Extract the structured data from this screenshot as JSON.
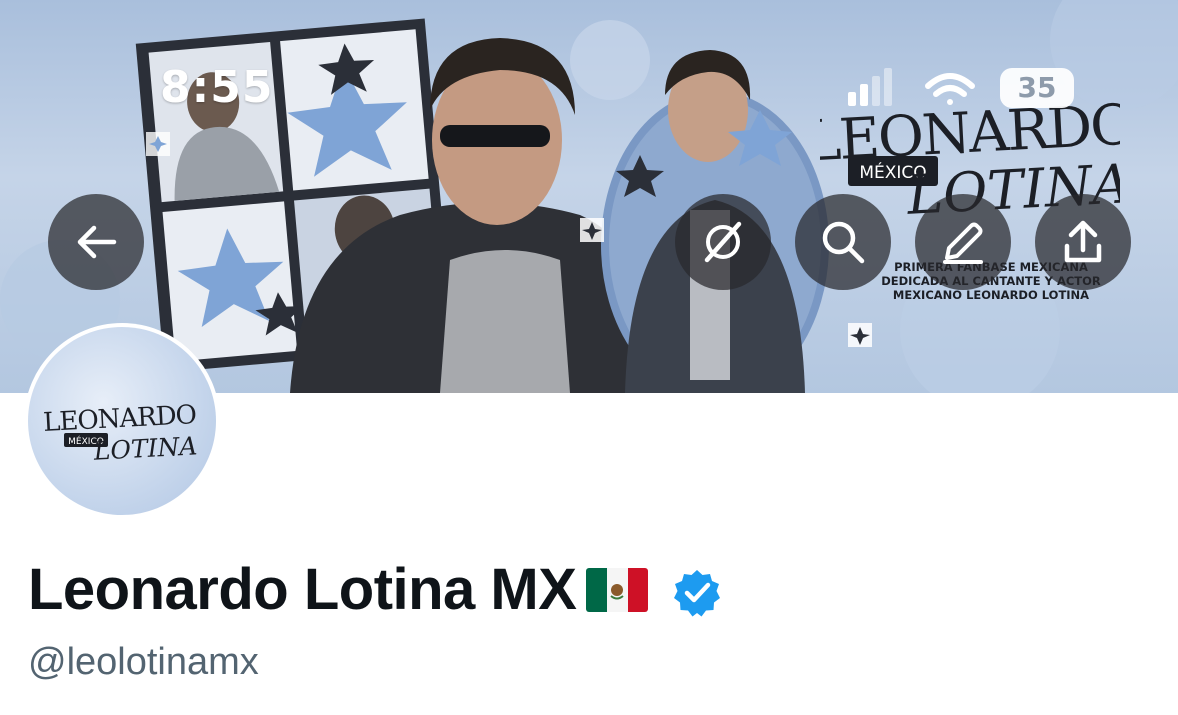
{
  "status_bar": {
    "time": "8:55",
    "battery_level": "35",
    "icons": [
      "cellular-signal-icon",
      "wifi-icon",
      "battery-icon"
    ]
  },
  "header_buttons": [
    {
      "name": "back-arrow-icon"
    },
    {
      "name": "grok-icon"
    },
    {
      "name": "search-icon"
    },
    {
      "name": "edit-pencil-icon"
    },
    {
      "name": "share-upload-icon"
    }
  ],
  "banner": {
    "logo_line1": "LEONARDO",
    "logo_badge": "MÉXICO",
    "logo_line2": "LOTINA",
    "tagline_1": "PRIMERA FANBASE MEXICANA",
    "tagline_2": "DEDICADA AL CANTANTE Y ACTOR",
    "tagline_3": "MEXICANO LEONARDO LOTINA"
  },
  "avatar": {
    "logo_line1": "LEONARDO",
    "logo_badge": "MÉXICO",
    "logo_line2": "LOTINA"
  },
  "profile": {
    "display_name": "Leonardo Lotina MX",
    "handle": "@leolotinamx",
    "verified": true
  },
  "colors": {
    "verified_blue": "#1d9bf0",
    "name_text": "#0f1419",
    "handle_text": "#536471",
    "banner_blue": "#a9bfdc"
  }
}
